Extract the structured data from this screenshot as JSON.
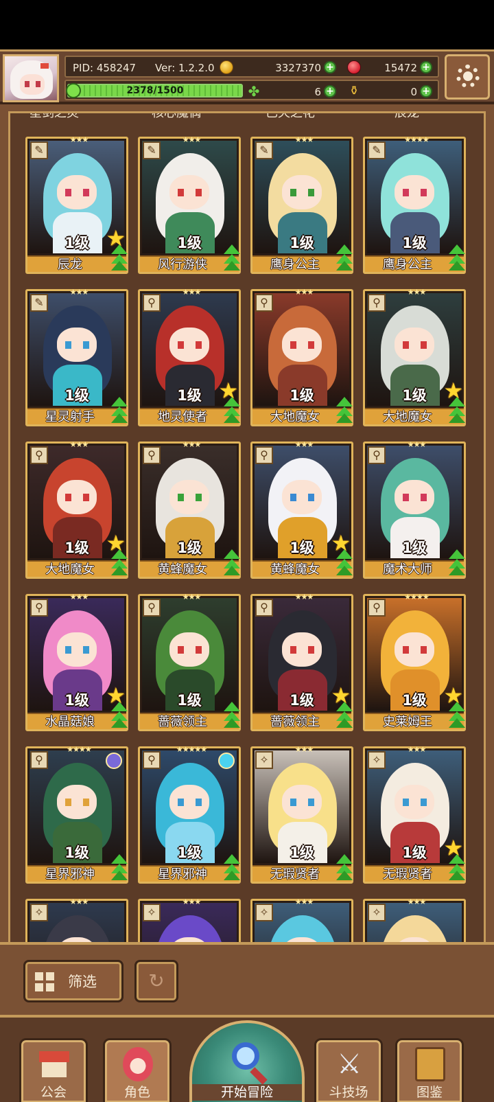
{
  "header": {
    "pid": "PID: 458247",
    "version": "Ver: 1.2.2.0",
    "gold": "3327370",
    "gems": "15472",
    "xp_text": "2378/1500",
    "xp_fraction": 1.0,
    "clover_count": "6",
    "potion_count": "0"
  },
  "top_partial_names": [
    "星剑之灵",
    "核心魔偶",
    "已灭之花",
    "辰龙"
  ],
  "characters": [
    {
      "name": "辰龙",
      "level": "1级",
      "stars": "★★★",
      "cls": "wing",
      "hair": "#7fd3e0",
      "body": "#e9f2f6",
      "eye": "#d23a5a",
      "bg": "#4a5e7a",
      "star_badge": true,
      "orb": ""
    },
    {
      "name": "风行游侠",
      "level": "1级",
      "stars": "★★★",
      "cls": "wing",
      "hair": "#f1eeea",
      "body": "#3f8a5a",
      "eye": "#d23a3a",
      "bg": "#2e4a4a",
      "star_badge": false,
      "orb": ""
    },
    {
      "name": "鹰身公主",
      "level": "1级",
      "stars": "★★★",
      "cls": "wing",
      "hair": "#f3dca0",
      "body": "#3a7a82",
      "eye": "#3a9a3a",
      "bg": "#2e4e5a",
      "star_badge": false,
      "orb": ""
    },
    {
      "name": "鹰身公主",
      "level": "1级",
      "stars": "★★★★",
      "cls": "wing",
      "hair": "#8fe2da",
      "body": "#4a5a7a",
      "eye": "#d23a5a",
      "bg": "#3e5e7a",
      "star_badge": false,
      "orb": ""
    },
    {
      "name": "星灵射手",
      "level": "1级",
      "stars": "★★★",
      "cls": "wing",
      "hair": "#2a3a5a",
      "body": "#3ab8c8",
      "eye": "#3a9ad2",
      "bg": "#3e4e6a",
      "star_badge": false,
      "orb": ""
    },
    {
      "name": "地灵使者",
      "level": "1级",
      "stars": "★★★",
      "cls": "key",
      "hair": "#b8302a",
      "body": "#2a2a32",
      "eye": "#d23a3a",
      "bg": "#2e3a4e",
      "star_badge": true,
      "orb": ""
    },
    {
      "name": "大地魔女",
      "level": "1级",
      "stars": "★★★",
      "cls": "key",
      "hair": "#c86a3a",
      "body": "#8a3a2a",
      "eye": "#d23a3a",
      "bg": "#8a3a2a",
      "star_badge": false,
      "orb": ""
    },
    {
      "name": "大地魔女",
      "level": "1级",
      "stars": "★★★",
      "cls": "key",
      "hair": "#d8dcd6",
      "body": "#4a6a4a",
      "eye": "#d23a3a",
      "bg": "#2e3e3e",
      "star_badge": true,
      "orb": ""
    },
    {
      "name": "大地魔女",
      "level": "1级",
      "stars": "★★★",
      "cls": "key",
      "hair": "#c8442e",
      "body": "#7a2a22",
      "eye": "#d23a3a",
      "bg": "#3e2a2a",
      "star_badge": true,
      "orb": ""
    },
    {
      "name": "黄蜂魔女",
      "level": "1级",
      "stars": "★★★",
      "cls": "key",
      "hair": "#e8e4de",
      "body": "#d8a23a",
      "eye": "#3aa23a",
      "bg": "#3a2e2a",
      "star_badge": false,
      "orb": ""
    },
    {
      "name": "黄蜂魔女",
      "level": "1级",
      "stars": "★★★",
      "cls": "key",
      "hair": "#f2f2f6",
      "body": "#e0a02a",
      "eye": "#3a8ad2",
      "bg": "#3e4e6a",
      "star_badge": true,
      "orb": ""
    },
    {
      "name": "魔术大师",
      "level": "1级",
      "stars": "★★★",
      "cls": "key",
      "hair": "#5ab8a0",
      "body": "#f4f0ee",
      "eye": "#d23a5a",
      "bg": "#3e4e6a",
      "star_badge": false,
      "orb": ""
    },
    {
      "name": "水晶菇娘",
      "level": "1级",
      "stars": "★★★",
      "cls": "key",
      "hair": "#f08ac8",
      "body": "#6a3a8a",
      "eye": "#3a9ad2",
      "bg": "#3a2a5a",
      "star_badge": true,
      "orb": ""
    },
    {
      "name": "蔷薇领主",
      "level": "1级",
      "stars": "★★★",
      "cls": "key",
      "hair": "#4a8a3a",
      "body": "#2a4a2a",
      "eye": "#d23a3a",
      "bg": "#2e3e2e",
      "star_badge": false,
      "orb": ""
    },
    {
      "name": "蔷薇领主",
      "level": "1级",
      "stars": "★★★",
      "cls": "key",
      "hair": "#2a2a32",
      "body": "#8a2a32",
      "eye": "#d23a3a",
      "bg": "#3a2a3a",
      "star_badge": true,
      "orb": ""
    },
    {
      "name": "史莱姆王",
      "level": "1级",
      "stars": "★★★★",
      "cls": "key",
      "hair": "#f2b23a",
      "body": "#e0902a",
      "eye": "#d23a3a",
      "bg": "#c8702a",
      "star_badge": true,
      "orb": ""
    },
    {
      "name": "星界邪神",
      "level": "1级",
      "stars": "★★★★",
      "cls": "key",
      "hair": "#2e6a4a",
      "body": "#3a6a3a",
      "eye": "#e0a23a",
      "bg": "#2e3e4e",
      "star_badge": false,
      "orb": "#7a6ad8"
    },
    {
      "name": "星界邪神",
      "level": "1级",
      "stars": "★★★★★",
      "cls": "key",
      "hair": "#3ab8d8",
      "body": "#8ad8f0",
      "eye": "#3a9ad2",
      "bg": "#2e4a6a",
      "star_badge": false,
      "orb": "#4ad2f0"
    },
    {
      "name": "无瑕贤者",
      "level": "1级",
      "stars": "★★★",
      "cls": "cross",
      "hair": "#f8e08a",
      "body": "#f4f0e8",
      "eye": "#3a9ad2",
      "bg": "#c8c0b8",
      "star_badge": false,
      "orb": ""
    },
    {
      "name": "无瑕贤者",
      "level": "1级",
      "stars": "★★★",
      "cls": "cross",
      "hair": "#f4ece0",
      "body": "#b83a3a",
      "eye": "#3a9ad2",
      "bg": "#3e5e7a",
      "star_badge": true,
      "orb": ""
    }
  ],
  "partial_row": [
    {
      "stars": "★★★",
      "cls": "cross",
      "hair": "#3a3a48",
      "bg": "#2e3a4e"
    },
    {
      "stars": "★★★",
      "cls": "cross",
      "hair": "#6a4ac8",
      "bg": "#3a2a5a"
    },
    {
      "stars": "★★★",
      "cls": "cross",
      "hair": "#5ac8e0",
      "bg": "#3e5e7a"
    },
    {
      "stars": "★★★",
      "cls": "cross",
      "hair": "#f4d89a",
      "bg": "#3e5e7a"
    }
  ],
  "filter": {
    "label": "筛选"
  },
  "nav": {
    "guild": "公会",
    "character": "角色",
    "adventure": "开始冒险",
    "arena": "斗技场",
    "codex": "图鉴"
  }
}
